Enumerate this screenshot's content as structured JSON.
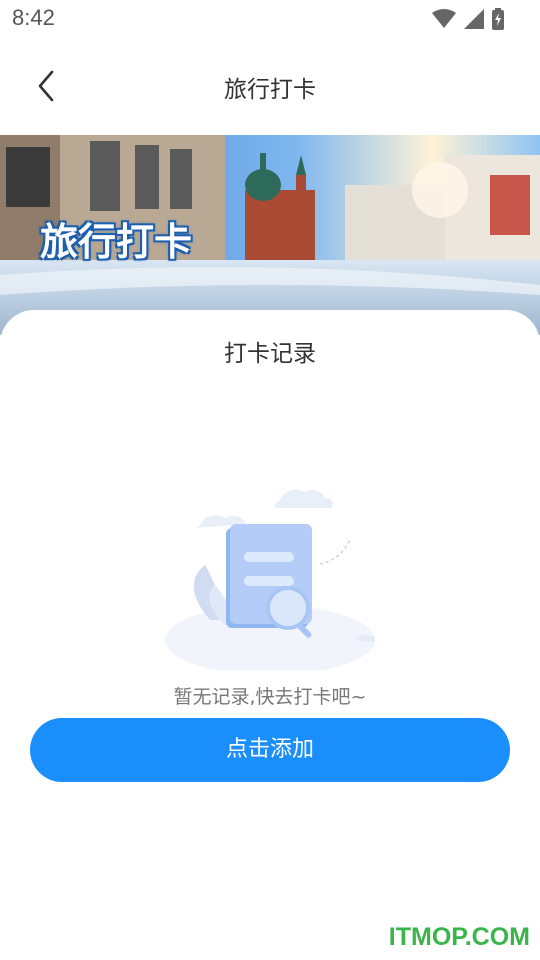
{
  "status_bar": {
    "time": "8:42",
    "icons": [
      "wifi-icon",
      "signal-icon",
      "battery-icon"
    ]
  },
  "nav": {
    "title": "旅行打卡",
    "back_icon": "chevron-left-icon"
  },
  "banner": {
    "overlay_text": "旅行打卡"
  },
  "records": {
    "title": "打卡记录",
    "empty_message": "暂无记录,快去打卡吧~",
    "illustration_icon": "empty-document-search-icon"
  },
  "actions": {
    "add_label": "点击添加"
  },
  "watermark": {
    "text": "ITMOP.COM"
  },
  "colors": {
    "accent": "#1a8ffb",
    "watermark": "#39b54a",
    "title_text": "#333333",
    "muted_text": "#777777"
  }
}
